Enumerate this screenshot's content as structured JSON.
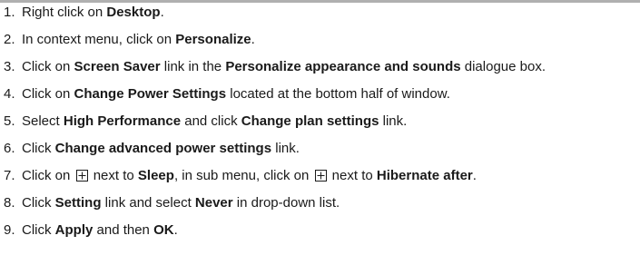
{
  "steps": [
    {
      "num": "1.",
      "parts": [
        {
          "t": "Right click on "
        },
        {
          "t": "Desktop",
          "b": true
        },
        {
          "t": "."
        }
      ]
    },
    {
      "num": "2.",
      "parts": [
        {
          "t": "In context menu, click on "
        },
        {
          "t": "Personalize",
          "b": true
        },
        {
          "t": "."
        }
      ]
    },
    {
      "num": "3.",
      "parts": [
        {
          "t": "Click on "
        },
        {
          "t": "Screen Saver",
          "b": true
        },
        {
          "t": " link in the "
        },
        {
          "t": "Personalize appearance and sounds",
          "b": true
        },
        {
          "t": " dialogue box."
        }
      ]
    },
    {
      "num": "4.",
      "parts": [
        {
          "t": "Click on "
        },
        {
          "t": "Change Power Settings",
          "b": true
        },
        {
          "t": " located at the bottom half of window."
        }
      ]
    },
    {
      "num": "5.",
      "parts": [
        {
          "t": "Select "
        },
        {
          "t": "High Performance",
          "b": true
        },
        {
          "t": " and click "
        },
        {
          "t": "Change plan settings",
          "b": true
        },
        {
          "t": " link."
        }
      ]
    },
    {
      "num": "6.",
      "parts": [
        {
          "t": "Click "
        },
        {
          "t": "Change advanced power settings",
          "b": true
        },
        {
          "t": " link."
        }
      ]
    },
    {
      "num": "7.",
      "parts": [
        {
          "t": "Click on "
        },
        {
          "icon": "plus-box-icon"
        },
        {
          "t": " next to "
        },
        {
          "t": "Sleep",
          "b": true
        },
        {
          "t": ", in sub menu, click on "
        },
        {
          "icon": "plus-box-icon"
        },
        {
          "t": " next to "
        },
        {
          "t": "Hibernate after",
          "b": true
        },
        {
          "t": "."
        }
      ]
    },
    {
      "num": "8.",
      "parts": [
        {
          "t": "Click "
        },
        {
          "t": "Setting",
          "b": true
        },
        {
          "t": " link and select "
        },
        {
          "t": "Never",
          "b": true
        },
        {
          "t": " in drop-down list."
        }
      ]
    },
    {
      "num": "9.",
      "parts": [
        {
          "t": "Click "
        },
        {
          "t": "Apply",
          "b": true
        },
        {
          "t": " and then "
        },
        {
          "t": "OK",
          "b": true
        },
        {
          "t": "."
        }
      ]
    }
  ]
}
